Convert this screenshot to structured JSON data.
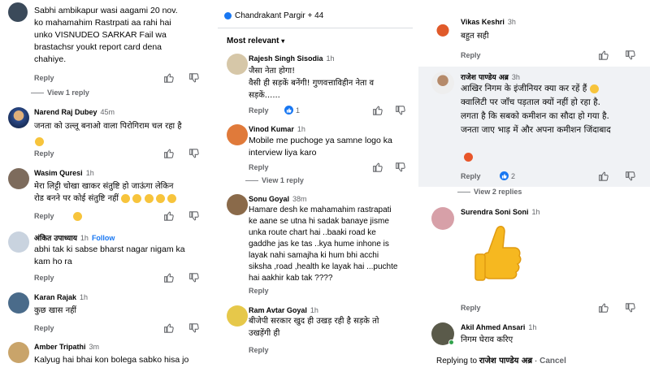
{
  "panel1": {
    "comments": [
      {
        "text": [
          "Sabhi ambikapur wasi aagami 20 nov.",
          "ko mahamahim Rastrpati aa rahi hai",
          "unko VISNUDEO SARKAR Fail wa",
          "brastachsr youkt report card dena",
          "chahiye."
        ],
        "reply": "Reply",
        "view": "View 1 reply"
      },
      {
        "name": "Narend Raj Dubey",
        "time": "45m",
        "text": "जनता को उल्लू बनाओ वाला पिरोगिराम चल रहा है",
        "reply": "Reply"
      },
      {
        "name": "Wasim Quresi",
        "time": "1h",
        "text": [
          "मेरा लिट्टी चोखा खाकर संतुष्टि हो जाऊंगा लेकिन",
          "रोड बनने पर कोई संतुष्टि नहीं"
        ],
        "reply": "Reply"
      },
      {
        "name": "अंकित उपाध्याय",
        "time": "1h",
        "follow": "Follow",
        "text": [
          "abhi tak ki sabse bharst nagar nigam ka",
          "kam ho ra"
        ],
        "reply": "Reply"
      },
      {
        "name": "Karan Rajak",
        "time": "1h",
        "text": "कुछ खास नहीं",
        "reply": "Reply"
      },
      {
        "name": "Amber Tripathi",
        "time": "3m",
        "text": "Kalyug hai bhai kon bolega sabko hisa jo"
      }
    ]
  },
  "panel2": {
    "header": "Chandrakant Pargir + 44",
    "sort": "Most relevant",
    "comments": [
      {
        "name": "Rajesh Singh Sisodia",
        "time": "1h",
        "text": [
          "जैसा नेता होगा!",
          "वैसी ही सड़कें बनेंगी! गुणवत्ताविहीन नेता व",
          "सड़कें......"
        ],
        "reply": "Reply",
        "likes": "1"
      },
      {
        "name": "Vinod Kumar",
        "time": "1h",
        "text": [
          "Mobile me puchoge ya samne logo ka",
          "interview liya karo"
        ],
        "reply": "Reply",
        "view": "View 1 reply"
      },
      {
        "name": "Sonu Goyal",
        "time": "38m",
        "text": [
          "Hamare desh ke mahamahim  rastrapati",
          "ke aane se utna hi sadak banaye jisme",
          "unka route chart hai ..baaki road ke",
          "gaddhe jas ke tas ..kya hume inhone is",
          "layak nahi samajha ki hum bhi acchi",
          "siksha ,road ,health ke layak hai ...puchte",
          "hai aakhir kab tak ????"
        ],
        "reply": "Reply"
      },
      {
        "name": "Ram Avtar Goyal",
        "time": "1h",
        "text": [
          "बीजेपी सरकार खुद ही उखड़ रही है सड़के तो",
          "उखड़ेंगी ही"
        ],
        "reply": "Reply"
      }
    ]
  },
  "panel3": {
    "comments": [
      {
        "name": "Vikas Keshri",
        "time": "3h",
        "text": "बहुत सही",
        "reply": "Reply"
      },
      {
        "name": "राजेश पाण्डेय अब्र",
        "time": "3h",
        "text": [
          "आखिर निगम के इंजीनियर क्या कर रहें हैं",
          "क्वालिटी पर जाँच पड़ताल क्यों नहीं हो रहा है.",
          "लगता है कि सबको कमीशन का सौदा हो गया है.",
          "जनता जाए भाड़ में और अपना कमीशन जिंदाबाद"
        ],
        "reply": "Reply",
        "likes": "2",
        "view": "View 2 replies"
      },
      {
        "name": "Surendra Soni Soni",
        "time": "1h",
        "reply": "Reply"
      },
      {
        "name": "Akil Ahmed Ansari",
        "time": "1h",
        "text": "निगम घेराव करिए"
      }
    ],
    "replying": {
      "prefix": "Replying to",
      "name": "राजेश पाण्डेय अब्र",
      "sep": " · ",
      "cancel": "Cancel"
    }
  },
  "colors": {
    "accent": "#1877f2",
    "muted": "#65676b",
    "highlight": "#f0f2f5"
  }
}
